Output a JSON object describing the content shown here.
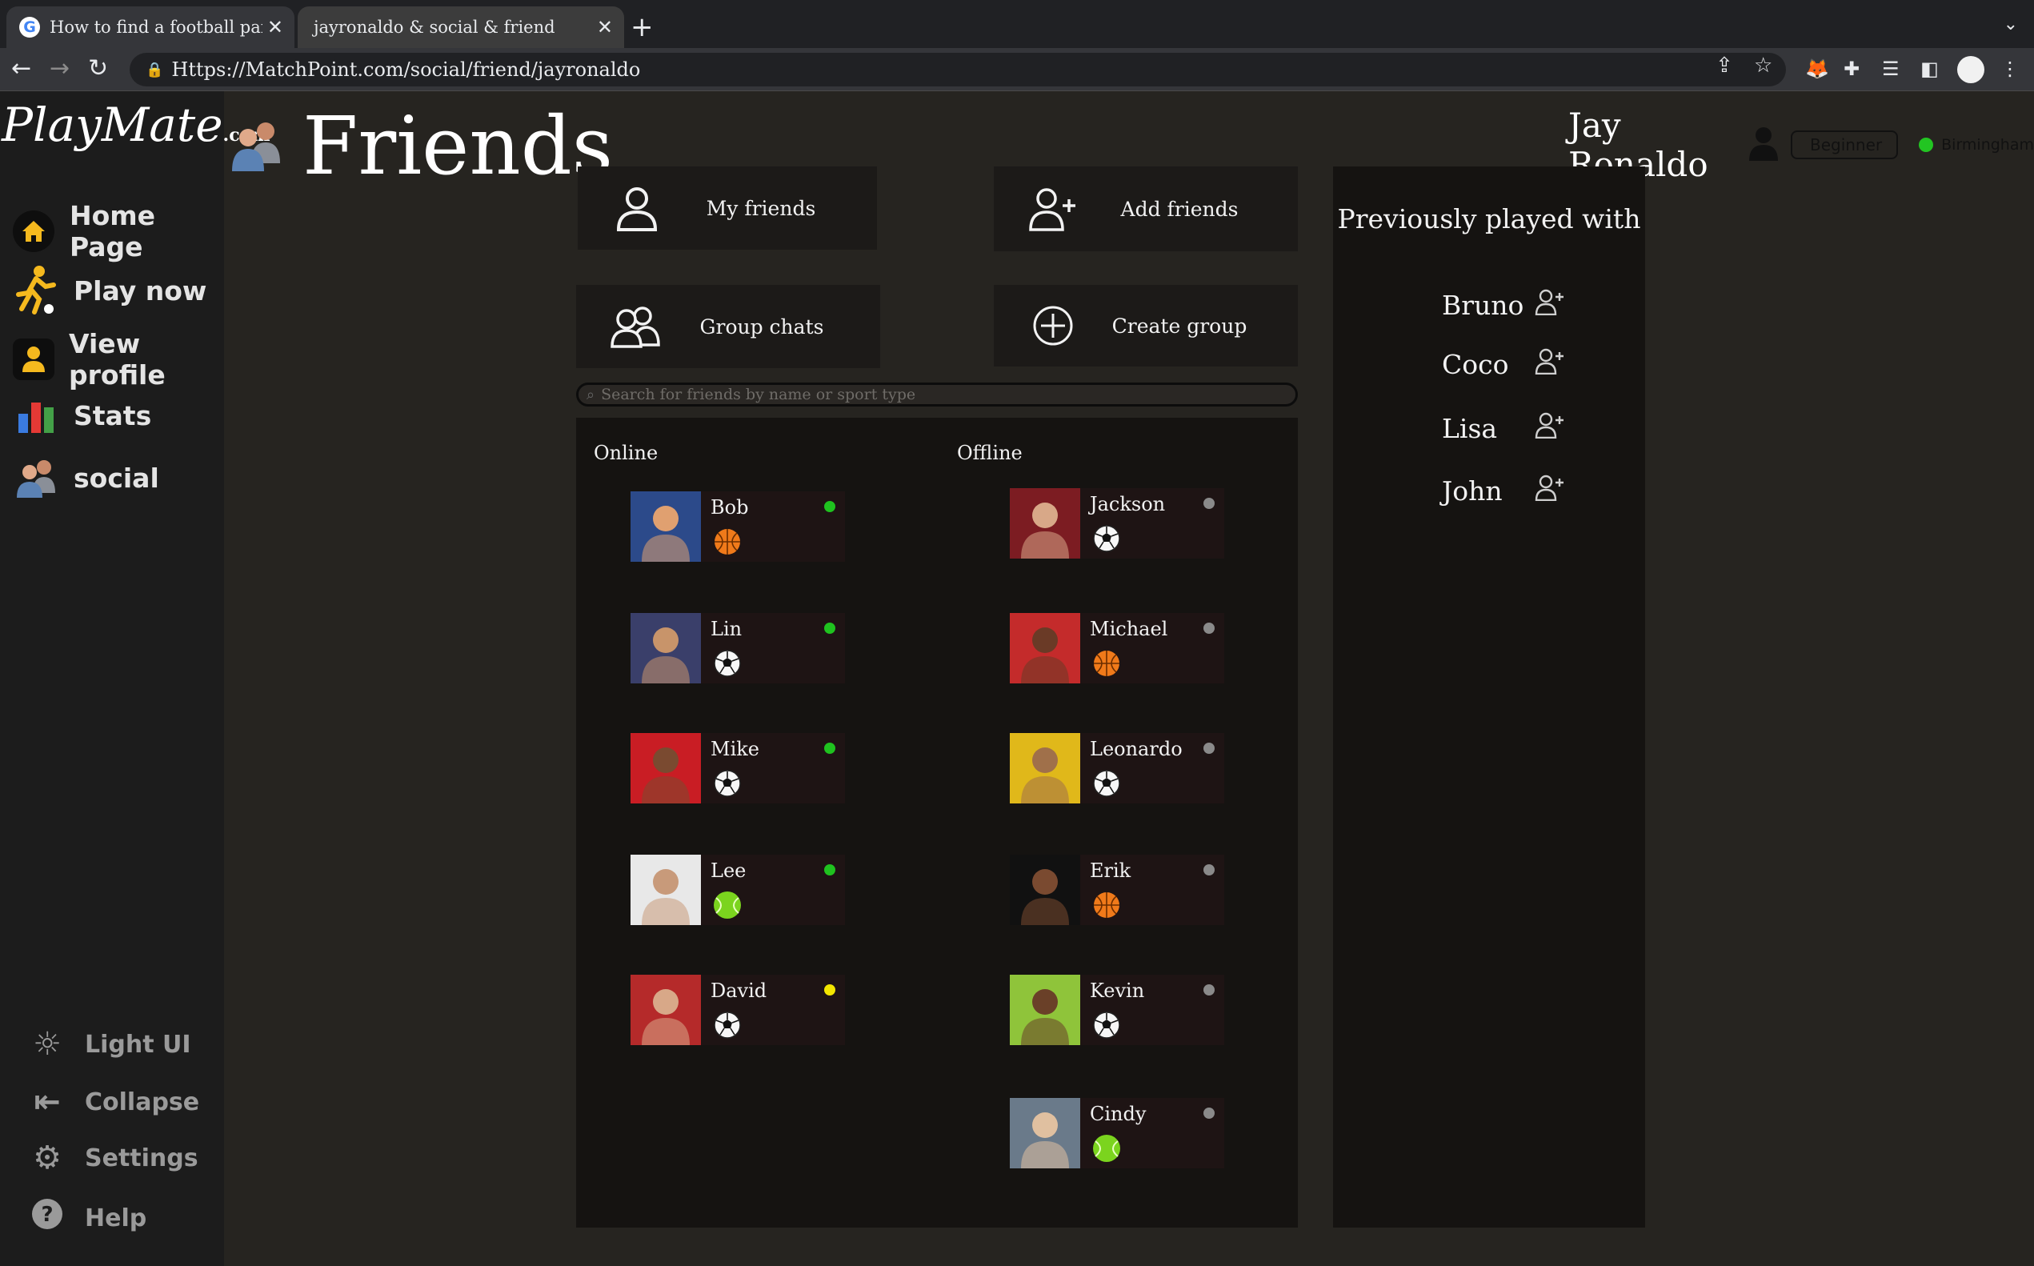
{
  "browser": {
    "tabs": [
      {
        "label": "How to find a football partner",
        "favicon": "google-icon"
      },
      {
        "label": "jayronaldo & social & friend",
        "favicon": ""
      }
    ],
    "url": "Https://MatchPoint.com/social/friend/jayronaldo"
  },
  "logo": {
    "main": "PlayMate",
    "domain": ".com"
  },
  "sidebar": {
    "items": [
      {
        "label": "Home Page",
        "icon": "home-icon"
      },
      {
        "label": "Play now",
        "icon": "running-person-icon"
      },
      {
        "label": "View profile",
        "icon": "person-icon"
      },
      {
        "label": "Stats",
        "icon": "bar-chart-icon"
      },
      {
        "label": "social",
        "icon": "people-icon"
      }
    ],
    "bottom_items": [
      {
        "label": "Light UI",
        "icon": "brightness-icon"
      },
      {
        "label": "Collapse",
        "icon": "collapse-icon"
      },
      {
        "label": "Settings",
        "icon": "gear-icon"
      },
      {
        "label": "Help",
        "icon": "help-icon"
      }
    ]
  },
  "header": {
    "title": "Friends",
    "user_name": "Jay Ronaldo",
    "level": "Beginner",
    "location": "Birmingham",
    "location_status_color": "#22c522"
  },
  "actions": {
    "my_friends": "My friends",
    "add_friends": "Add friends",
    "group_chats": "Group chats",
    "create_group": "Create group"
  },
  "search": {
    "placeholder": "Search for friends by name or sport type"
  },
  "online": {
    "heading": "Online",
    "friends": [
      {
        "name": "Bob",
        "sport": "basketball",
        "status": "online"
      },
      {
        "name": "Lin",
        "sport": "football",
        "status": "online"
      },
      {
        "name": "Mike",
        "sport": "football",
        "status": "online"
      },
      {
        "name": "Lee",
        "sport": "tennis",
        "status": "online"
      },
      {
        "name": "David",
        "sport": "football",
        "status": "away"
      }
    ]
  },
  "offline": {
    "heading": "Offline",
    "friends": [
      {
        "name": "Jackson",
        "sport": "football",
        "status": "offline"
      },
      {
        "name": "Michael",
        "sport": "basketball",
        "status": "offline"
      },
      {
        "name": "Leonardo",
        "sport": "football",
        "status": "offline"
      },
      {
        "name": "Erik",
        "sport": "basketball",
        "status": "offline"
      },
      {
        "name": "Kevin",
        "sport": "football",
        "status": "offline"
      },
      {
        "name": "Cindy",
        "sport": "tennis",
        "status": "offline"
      }
    ]
  },
  "status_colors": {
    "online": "#1fc21f",
    "away": "#f2e600",
    "offline": "#8a8a8a"
  },
  "previously_played": {
    "title": "Previously played with",
    "people": [
      "Bruno",
      "Coco",
      "Lisa",
      "John"
    ]
  }
}
